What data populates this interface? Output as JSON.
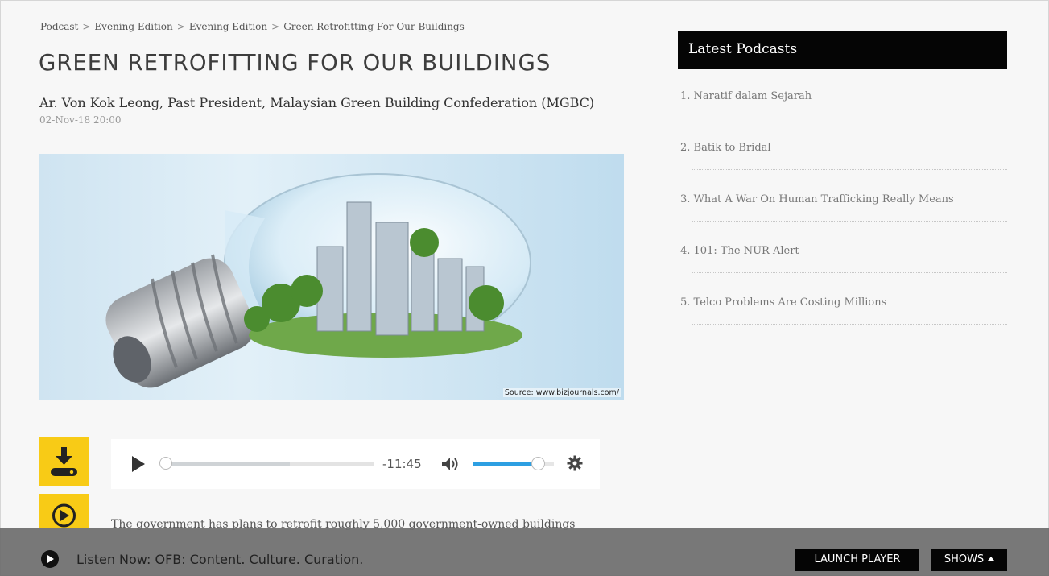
{
  "breadcrumb": [
    "Podcast",
    "Evening Edition",
    "Evening Edition",
    "Green Retrofitting For Our Buildings"
  ],
  "breadcrumb_separator": ">",
  "article": {
    "title": "GREEN RETROFITTING FOR OUR BUILDINGS",
    "byline": "Ar. Von Kok Leong, Past President, Malaysian Green Building Confederation (MGBC)",
    "date": "02-Nov-18 20:00",
    "image_caption": "Source: www.bizjournals.com/",
    "description": "The government has plans to retrofit roughly 5,000 government-owned buildings"
  },
  "player": {
    "time_remaining": "-11:45",
    "progress_fraction": 0.0,
    "buffered_fraction": 0.6,
    "volume_fraction": 0.8,
    "accent_color": "#2d9fe2"
  },
  "icons": {
    "download": "download-icon",
    "play_circle": "play-circle-icon",
    "play": "play-icon",
    "speaker": "speaker-icon",
    "settings": "gear-icon"
  },
  "sidebar": {
    "heading": "Latest Podcasts",
    "items": [
      {
        "label": "1. Naratif dalam Sejarah"
      },
      {
        "label": "2. Batik to Bridal"
      },
      {
        "label": "3. What A War On Human Trafficking Really Means"
      },
      {
        "label": "4. 101: The NUR Alert"
      },
      {
        "label": "5. Telco Problems Are Costing Millions"
      }
    ]
  },
  "bottom_bar": {
    "listen_text": "Listen Now: OFB: Content. Culture. Curation.",
    "launch_label": "LAUNCH PLAYER",
    "shows_label": "SHOWS"
  },
  "colors": {
    "accent_yellow": "#f8cb16",
    "header_black": "#050505",
    "bottom_bar": "#6e6e6e"
  }
}
